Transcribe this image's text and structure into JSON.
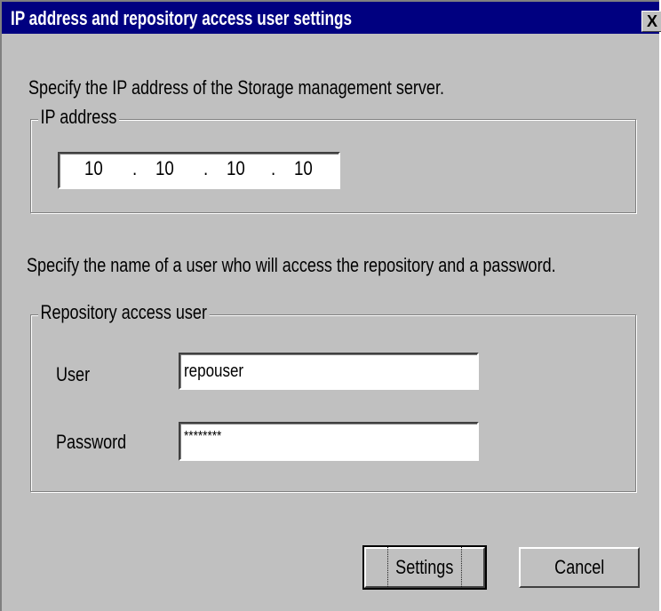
{
  "window": {
    "title": "IP address and repository access user settings",
    "close_glyph": "X"
  },
  "ip_section": {
    "instruction": "Specify the IP address of the Storage management server.",
    "group_label": "IP address",
    "octets": [
      "10",
      "10",
      "10",
      "10"
    ],
    "separator": "."
  },
  "user_section": {
    "instruction": "Specify the name of a user who will access the repository and a password.",
    "group_label": "Repository access user",
    "user_label": "User",
    "user_value": "repouser",
    "password_label": "Password",
    "password_value": "********"
  },
  "buttons": {
    "settings": "Settings",
    "cancel": "Cancel"
  },
  "colors": {
    "titlebar": "#000080",
    "face": "#c0c0c0"
  }
}
